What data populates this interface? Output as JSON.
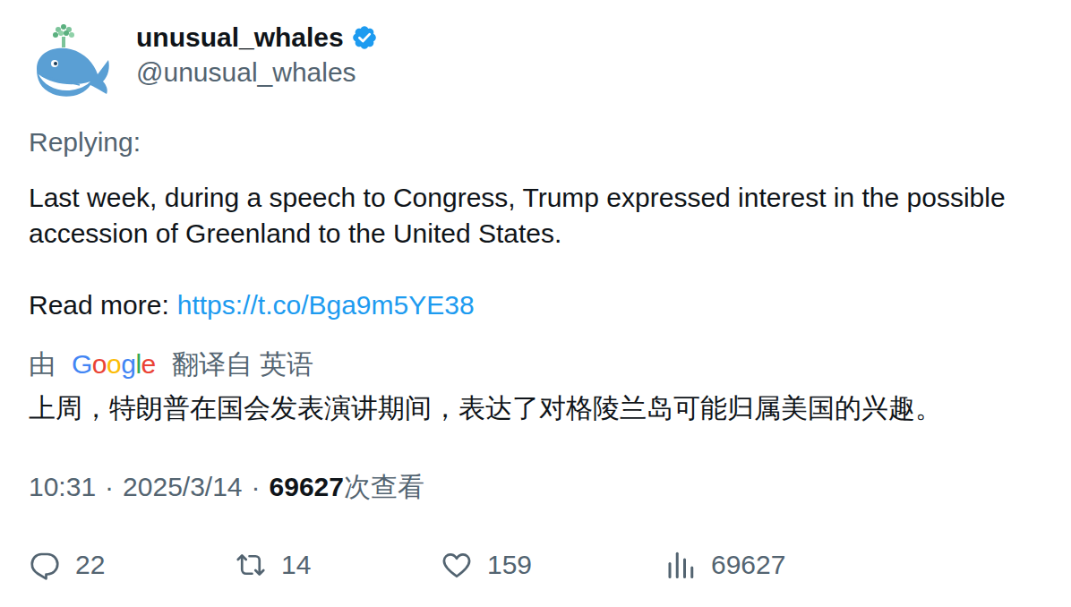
{
  "author": {
    "name": "unusual_whales",
    "handle": "@unusual_whales",
    "verified": true
  },
  "replying": "Replying:",
  "text": "Last week, during a speech to Congress, Trump expressed interest in the possible accession of Greenland to the United States.",
  "read_more": {
    "label": "Read more:",
    "link": "https://t.co/Bga9m5YE38"
  },
  "translation": {
    "prefix": "由",
    "provider": "Google",
    "suffix": "翻译自 英语",
    "text": "上周，特朗普在国会发表演讲期间，表达了对格陵兰岛可能归属美国的兴趣。"
  },
  "meta": {
    "time": "10:31",
    "separator": "·",
    "date": "2025/3/14",
    "views_count": "69627",
    "views_label": "次查看"
  },
  "actions": [
    {
      "kind": "reply",
      "count": "22"
    },
    {
      "kind": "retweet",
      "count": "14"
    },
    {
      "kind": "like",
      "count": "159"
    },
    {
      "kind": "views",
      "count": "69627"
    }
  ]
}
